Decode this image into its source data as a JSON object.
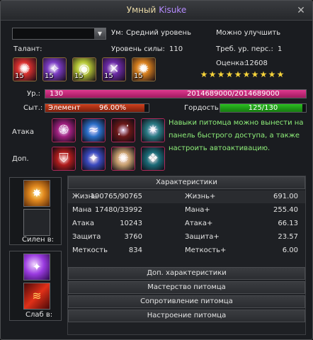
{
  "window": {
    "title_prefix": "Умный",
    "title_name": "Kisuke",
    "close_label": "✕"
  },
  "info": {
    "dropdown_value": "",
    "mind_label": "Ум:",
    "mind_value": "Средний уровень",
    "can_improve": "Можно улучшить",
    "talent_label": "Талант:",
    "power_label": "Уровень силы:",
    "power_value": "110",
    "req_label": "Треб. ур. перс.:",
    "req_value": "1",
    "score_label": "Оценка:",
    "score_value": "12608"
  },
  "talent_skills": [
    {
      "level": "15",
      "icon": "fire-skill-icon",
      "color": "#d8302e"
    },
    {
      "level": "15",
      "icon": "arcane-bolt-icon",
      "color": "#7a3bc2"
    },
    {
      "level": "15",
      "icon": "light-orb-icon",
      "color": "#b6c836"
    },
    {
      "level": "15",
      "icon": "violet-strike-icon",
      "color": "#6b2aa6"
    },
    {
      "level": "15",
      "icon": "flame-burst-icon",
      "color": "#d8801e"
    }
  ],
  "stars": {
    "count": 10,
    "color": "#f5d23a"
  },
  "level": {
    "label": "Ур.:",
    "value": "130",
    "exp_text": "2014689000/2014689000",
    "exp_fraction": 1.0,
    "color": "#e0388f"
  },
  "satiety": {
    "label": "Сыт.:",
    "text_left": "Элемент",
    "text_right": "96.00%",
    "fraction": 0.96,
    "color": "#d0401c"
  },
  "pride": {
    "label": "Гордость",
    "text": "125/130",
    "fraction": 0.9615,
    "color": "#2bbf20"
  },
  "attack_label": "Атака",
  "extra_label": "Доп.",
  "attack_skills": [
    {
      "icon": "spiral-skill-icon",
      "color": "#a02080"
    },
    {
      "icon": "wave-skill-icon",
      "color": "#2a6ec8"
    },
    {
      "icon": "dark-claw-icon",
      "color": "#6a1818"
    },
    {
      "icon": "compass-rune-icon",
      "color": "#2a7a84"
    }
  ],
  "extra_skills": [
    {
      "icon": "shield-skill-icon",
      "color": "#b01c1c"
    },
    {
      "icon": "star-burst-icon",
      "color": "#3a4ac0"
    },
    {
      "icon": "radiant-fan-icon",
      "color": "#c8a070"
    },
    {
      "icon": "teal-rune-icon",
      "color": "#1a6b78"
    }
  ],
  "hint": "Навыки питомца можно вынести на панель быстрого доступа, а также настроить автоактивацию.",
  "strong_label": "Силен в:",
  "weak_label": "Слаб в:",
  "stats": {
    "header": "Характеристики",
    "rows": [
      {
        "n1": "Жизнь",
        "v1": "190765/90765",
        "n2": "Жизнь+",
        "v2": "691.00"
      },
      {
        "n1": "Мана",
        "v1": "17480/33992",
        "n2": "Мана+",
        "v2": "255.40"
      },
      {
        "n1": "Атака",
        "v1": "10243",
        "n2": "Атака+",
        "v2": "66.13"
      },
      {
        "n1": "Защита",
        "v1": "3760",
        "n2": "Защита+",
        "v2": "23.57"
      },
      {
        "n1": "Меткость",
        "v1": "834",
        "n2": "Меткость+",
        "v2": "6.00"
      }
    ]
  },
  "sections": [
    "Доп. характеристики",
    "Мастерство питомца",
    "Сопротивление питомца",
    "Настроение питомца"
  ]
}
